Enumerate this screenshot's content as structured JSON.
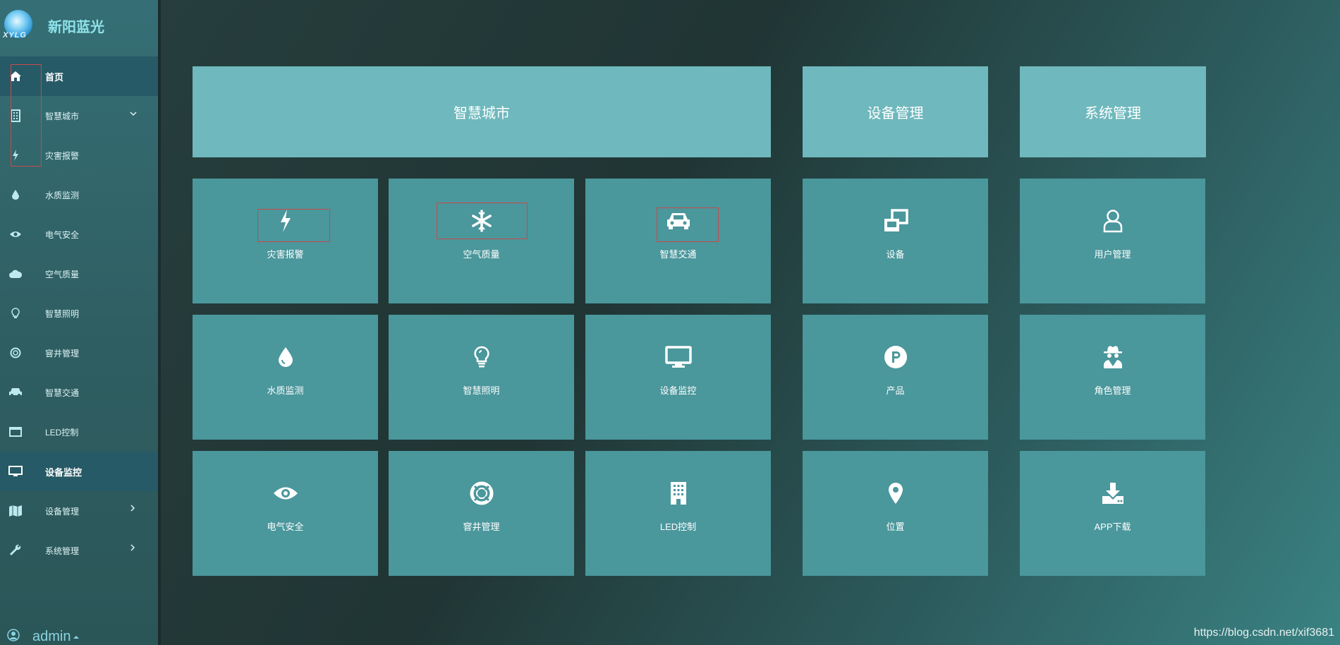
{
  "sidebar": {
    "brand": "新阳蓝光",
    "logo_text": "XYLG",
    "items": [
      {
        "label": "首页",
        "icon": "home-icon"
      },
      {
        "label": "智慧城市",
        "icon": "building-icon"
      },
      {
        "label": "灾害报警",
        "icon": "bolt-icon"
      },
      {
        "label": "水质监测",
        "icon": "drop-icon"
      },
      {
        "label": "电气安全",
        "icon": "eye-icon"
      },
      {
        "label": "空气质量",
        "icon": "cloud-icon"
      },
      {
        "label": "智慧照明",
        "icon": "bulb-icon"
      },
      {
        "label": "窨井管理",
        "icon": "lifebuoy-icon"
      },
      {
        "label": "智慧交通",
        "icon": "car-icon"
      },
      {
        "label": "LED控制",
        "icon": "led-panel-icon"
      },
      {
        "label": "设备监控",
        "icon": "monitor-icon"
      },
      {
        "label": "设备管理",
        "icon": "map-icon"
      },
      {
        "label": "系统管理",
        "icon": "wrench-icon"
      }
    ],
    "user": "admin"
  },
  "main": {
    "headers": [
      "智慧城市",
      "设备管理",
      "系统管理"
    ],
    "tiles": [
      {
        "label": "灾害报警",
        "icon": "bolt-icon"
      },
      {
        "label": "空气质量",
        "icon": "snowflake-icon"
      },
      {
        "label": "智慧交通",
        "icon": "car-icon"
      },
      {
        "label": "设备",
        "icon": "device-icon"
      },
      {
        "label": "用户管理",
        "icon": "user-icon"
      },
      {
        "label": "水质监测",
        "icon": "drop-icon"
      },
      {
        "label": "智慧照明",
        "icon": "bulb-icon"
      },
      {
        "label": "设备监控",
        "icon": "monitor-icon"
      },
      {
        "label": "产品",
        "icon": "product-p-icon"
      },
      {
        "label": "角色管理",
        "icon": "spy-icon"
      },
      {
        "label": "电气安全",
        "icon": "eye-icon"
      },
      {
        "label": "窨井管理",
        "icon": "lifebuoy-icon"
      },
      {
        "label": "LED控制",
        "icon": "building-icon"
      },
      {
        "label": "位置",
        "icon": "map-marker-icon"
      },
      {
        "label": "APP下载",
        "icon": "download-icon"
      }
    ]
  },
  "watermark": "https://blog.csdn.net/xif3681",
  "colors": {
    "tile": "#4a979c",
    "header_tile": "#6fb8bd",
    "sidebar_active": "#265a66",
    "annotation_red": "#c84a4a"
  }
}
